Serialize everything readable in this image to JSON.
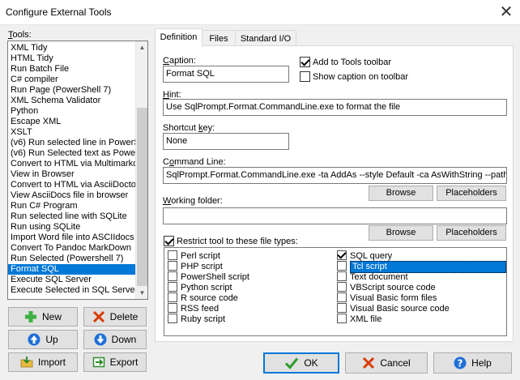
{
  "window": {
    "title": "Configure External Tools"
  },
  "tools": {
    "label": "Tools:",
    "items": [
      "XML Tidy",
      "HTML Tidy",
      "Run Batch File",
      "C# compiler",
      "Run Page (PowerShell 7)",
      "XML Schema Validator",
      "Python",
      "Escape XML",
      "XSLT",
      "(v6) Run selected line in PowerS",
      "(v6) Run Selected text as Power",
      "Convert to HTML via Multimarkdo",
      "View in Browser",
      "Convert to HTML via AsciiDoctor",
      "View AsciiDocs file in browser",
      "Run C# Program",
      "Run selected line with SQLite",
      "Run using SQLite",
      "Import  Word file into ASCIIdocs",
      "Convert To Pandoc MarkDown",
      "Run Selected (Powershell 7)",
      "Format SQL",
      "Execute SQL Server",
      "Execute Selected in SQL Server"
    ],
    "selected_index": 21,
    "new_label": "New",
    "delete_label": "Delete",
    "up_label": "Up",
    "down_label": "Down",
    "import_label": "Import",
    "export_label": "Export"
  },
  "tabs": [
    "Definition",
    "Files",
    "Standard I/O"
  ],
  "definition": {
    "caption_label": "Caption:",
    "caption_value": "Format SQL",
    "add_to_toolbar_label": "Add to Tools toolbar",
    "add_to_toolbar_checked": true,
    "show_caption_label": "Show caption on toolbar",
    "show_caption_checked": false,
    "hint_label": "Hint:",
    "hint_value": "Use SqlPrompt.Format.CommandLine.exe to format the file",
    "shortcut_label": "Shortcut key:",
    "shortcut_value": "None",
    "command_label": "Command Line:",
    "command_value": "SqlPrompt.Format.CommandLine.exe -ta AddAs --style Default -ca AsWithString --path %F",
    "browse_label": "Browse",
    "placeholders_label": "Placeholders",
    "working_folder_label": "Working folder:",
    "working_folder_value": "",
    "restrict_label": "Restrict tool to these file types:",
    "restrict_checked": true,
    "file_types_col1": [
      {
        "label": "Perl script",
        "checked": false
      },
      {
        "label": "PHP script",
        "checked": false
      },
      {
        "label": "PowerShell script",
        "checked": false
      },
      {
        "label": "Python script",
        "checked": false
      },
      {
        "label": "R source code",
        "checked": false
      },
      {
        "label": "RSS feed",
        "checked": false
      },
      {
        "label": "Ruby script",
        "checked": false
      }
    ],
    "file_types_col2": [
      {
        "label": "SQL query",
        "checked": true
      },
      {
        "label": "Tcl script",
        "checked": false
      },
      {
        "label": "Text document",
        "checked": false
      },
      {
        "label": "VBScript source code",
        "checked": false
      },
      {
        "label": "Visual Basic form files",
        "checked": false
      },
      {
        "label": "Visual Basic source code",
        "checked": false
      },
      {
        "label": "XML file",
        "checked": false
      }
    ]
  },
  "dialog": {
    "ok_label": "OK",
    "cancel_label": "Cancel",
    "help_label": "Help"
  }
}
